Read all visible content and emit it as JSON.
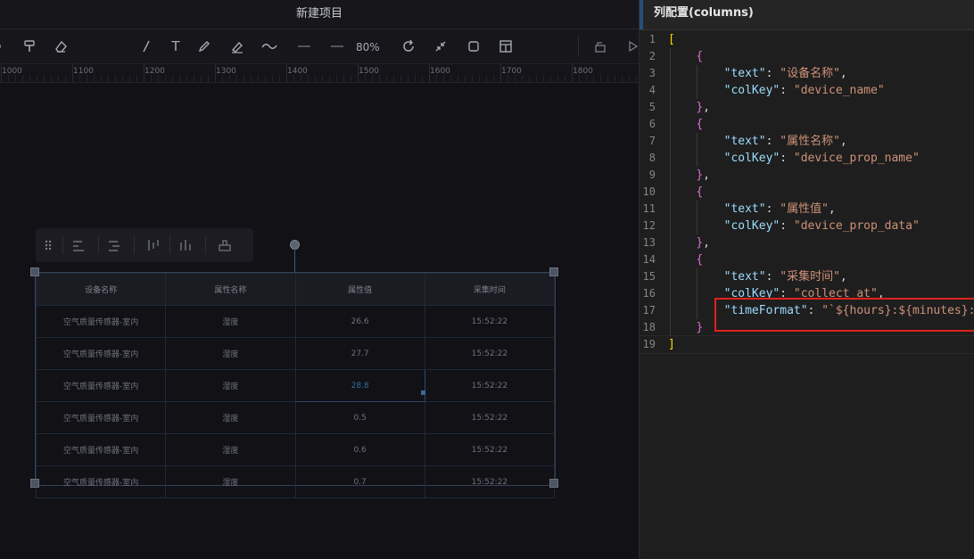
{
  "app": {
    "title": "新建项目"
  },
  "toolbar": {
    "zoom": "80%",
    "text_tool": "T"
  },
  "ruler": {
    "labels": [
      "1000",
      "1100",
      "1200",
      "1300",
      "1400",
      "1500",
      "1600",
      "1700",
      "1800"
    ]
  },
  "table": {
    "headers": [
      "设备名称",
      "属性名称",
      "属性值",
      "采集时间"
    ],
    "rows": [
      [
        "空气质量传感器-室内",
        "湿度",
        "26.6",
        "15:52:22"
      ],
      [
        "空气质量传感器-室内",
        "湿度",
        "27.7",
        "15:52:22"
      ],
      [
        "空气质量传感器-室内",
        "湿度",
        "28.8",
        "15:52:22"
      ],
      [
        "空气质量传感器-室内",
        "湿度",
        "0.5",
        "15:52:22"
      ],
      [
        "空气质量传感器-室内",
        "湿度",
        "0.6",
        "15:52:22"
      ],
      [
        "空气质量传感器-室内",
        "湿度",
        "0.7",
        "15:52:22"
      ]
    ],
    "selected_cell": "28.8"
  },
  "panel": {
    "title": "列配置(columns)",
    "line_numbers": [
      "1",
      "2",
      "3",
      "4",
      "5",
      "6",
      "7",
      "8",
      "9",
      "10",
      "11",
      "12",
      "13",
      "14",
      "15",
      "16",
      "17",
      "18",
      "19"
    ],
    "code_lines": [
      "[",
      "    {",
      "        \"text\": \"设备名称\",",
      "        \"colKey\": \"device_name\"",
      "    },",
      "    {",
      "        \"text\": \"属性名称\",",
      "        \"colKey\": \"device_prop_name\"",
      "    },",
      "    {",
      "        \"text\": \"属性值\",",
      "        \"colKey\": \"device_prop_data\"",
      "    },",
      "    {",
      "        \"text\": \"采集时间\",",
      "        \"colKey\": \"collect_at\",",
      "        \"timeFormat\": \"`${hours}:${minutes}:${",
      "    }",
      "]"
    ]
  },
  "colors": {
    "highlight_box": "#e0211a",
    "selection": "#3a5c85",
    "key": "#9cdcfe",
    "string": "#ce9178"
  }
}
